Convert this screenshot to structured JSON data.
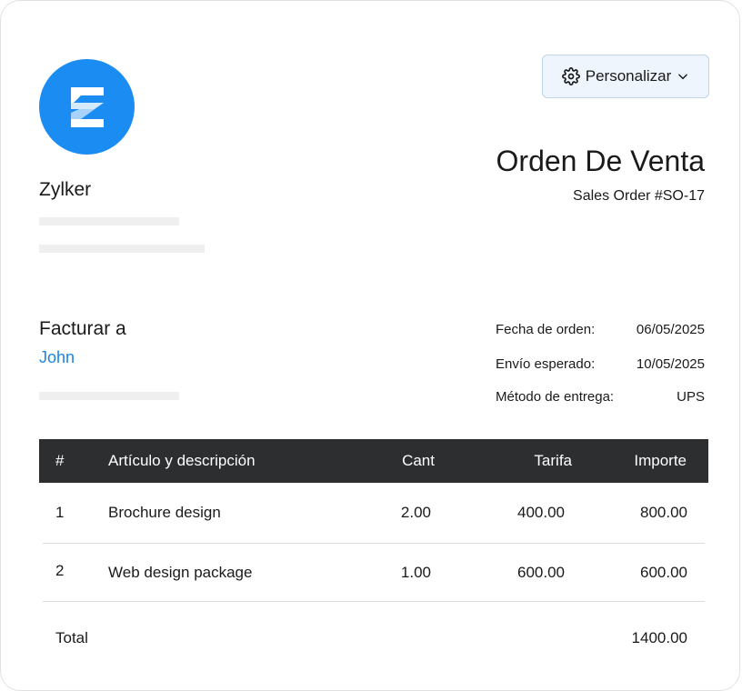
{
  "toolbar": {
    "customize_label": "Personalizar"
  },
  "company": {
    "logo_letter": "Z",
    "name": "Zylker"
  },
  "document": {
    "title": "Orden De Venta",
    "number": "Sales Order #SO-17"
  },
  "billing": {
    "label": "Facturar a",
    "customer": "John"
  },
  "meta": [
    {
      "label": "Fecha de orden:",
      "value": "06/05/2025"
    },
    {
      "label": "Envío esperado:",
      "value": "10/05/2025"
    },
    {
      "label": "Método de entrega:",
      "value": "UPS"
    }
  ],
  "table": {
    "headers": [
      "#",
      "Artículo y descripción",
      "Cant",
      "Tarifa",
      "Importe"
    ],
    "rows": [
      {
        "num": "1",
        "item": "Brochure design",
        "qty": "2.00",
        "rate": "400.00",
        "amount": "800.00"
      },
      {
        "num": "2",
        "item": "Web design package",
        "qty": "1.00",
        "rate": "600.00",
        "amount": "600.00"
      }
    ],
    "total_label": "Total",
    "total_value": "1400.00"
  },
  "colors": {
    "brand": "#1a8cf2",
    "link": "#1a85e8",
    "table_header": "#2d2e30",
    "button_bg": "#eef5fc"
  }
}
